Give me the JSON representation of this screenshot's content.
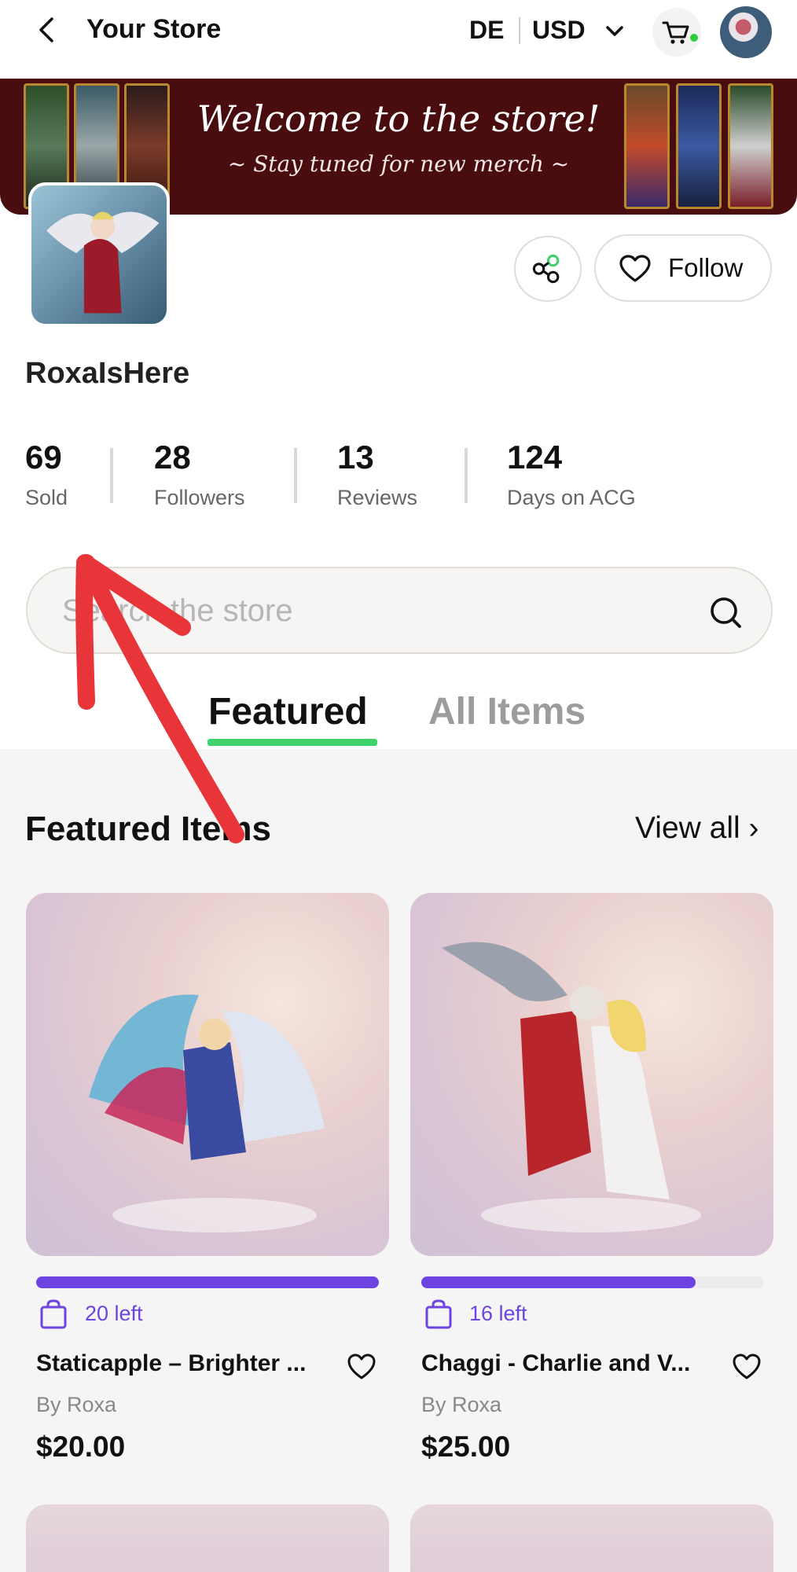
{
  "header": {
    "title": "Your Store",
    "language": "DE",
    "currency": "USD"
  },
  "banner": {
    "title": "Welcome to the store!",
    "subtitle": "~ Stay tuned for new merch ~"
  },
  "profile": {
    "store_name": "RoxaIsHere",
    "follow_label": "Follow"
  },
  "stats": [
    {
      "value": "69",
      "label": "Sold"
    },
    {
      "value": "28",
      "label": "Followers"
    },
    {
      "value": "13",
      "label": "Reviews"
    },
    {
      "value": "124",
      "label": "Days on ACG"
    }
  ],
  "search": {
    "placeholder": "Search the store"
  },
  "tabs": [
    {
      "label": "Featured",
      "active": true
    },
    {
      "label": "All Items",
      "active": false
    }
  ],
  "featured": {
    "title": "Featured Items",
    "view_all": "View all ›",
    "items": [
      {
        "stock": "20 left",
        "stock_fraction": 1.0,
        "name": "Staticapple – Brighter ...",
        "by": "By Roxa",
        "price": "$20.00"
      },
      {
        "stock": "16 left",
        "stock_fraction": 0.8,
        "name": "Chaggi - Charlie and V...",
        "by": "By Roxa",
        "price": "$25.00"
      }
    ]
  },
  "colors": {
    "accent_purple": "#6e44e0",
    "tab_underline_green": "#3fd16b",
    "banner_background": "#4a0d0f",
    "annotation_red": "#e8353a"
  }
}
